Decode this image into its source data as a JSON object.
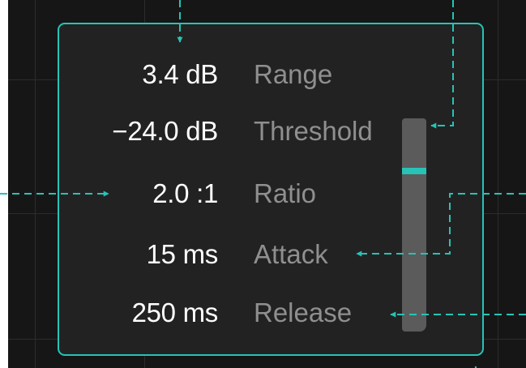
{
  "panel": {
    "rows": [
      {
        "value": "3.4 dB",
        "label": "Range"
      },
      {
        "value": "−24.0 dB",
        "label": "Threshold"
      },
      {
        "value": "2.0 :1",
        "label": "Ratio"
      },
      {
        "value": "15 ms",
        "label": "Attack"
      },
      {
        "value": "250 ms",
        "label": "Release"
      }
    ],
    "scrollbar": {
      "position": 0.24
    }
  },
  "colors": {
    "accent": "#27c3b6",
    "background": "#161616",
    "panel": "#222222",
    "value_text": "#ffffff",
    "label_text": "#8f8f8f"
  }
}
